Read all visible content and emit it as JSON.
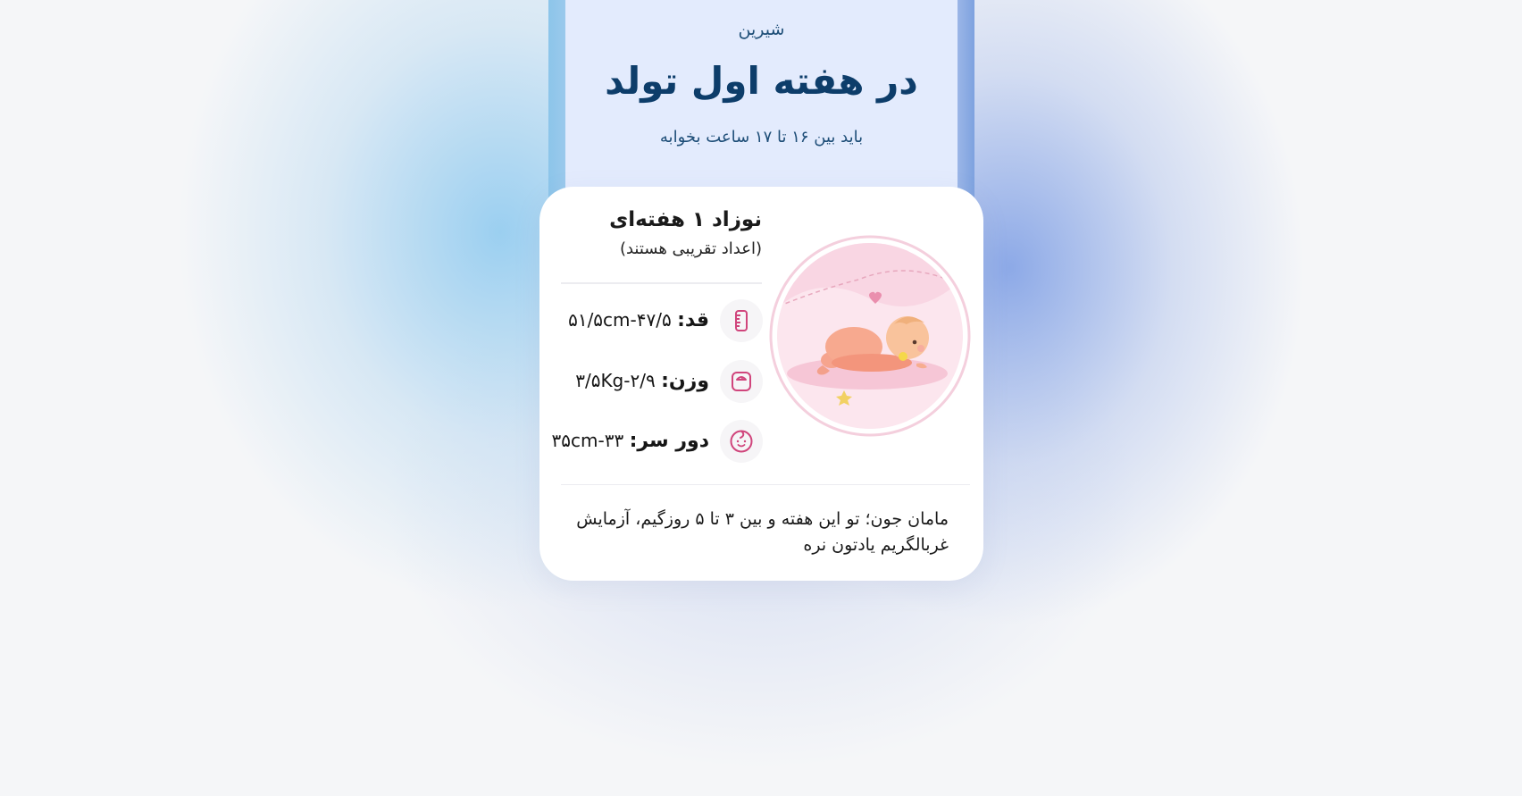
{
  "header": {
    "brand": "شیرین",
    "title": "در هفته اول تولد",
    "subtitle": "باید بین ۱۶ تا ۱۷ ساعت بخوابه"
  },
  "card": {
    "title": "نوزاد ۱ هفته‌ای",
    "note": "(اعداد تقریبی هستند)",
    "stats": [
      {
        "icon": "ruler-icon",
        "label": "قد:",
        "value": "۴۷/۵-۵۱/۵cm"
      },
      {
        "icon": "scale-icon",
        "label": "وزن:",
        "value": "۲/۹-۳/۵Kg"
      },
      {
        "icon": "baby-head-icon",
        "label": "دور سر:",
        "value": "۳۳-۳۵cm"
      }
    ],
    "tip": "مامان جون؛ تو این هفته و بین ۳ تا ۵ روزگیم، آزمایش غربالگریم یادتون نره"
  },
  "colors": {
    "header_bg": "#e3ebfd",
    "title": "#0d3d6a",
    "icon_accent": "#d0457c",
    "card_bg": "#ffffff"
  }
}
